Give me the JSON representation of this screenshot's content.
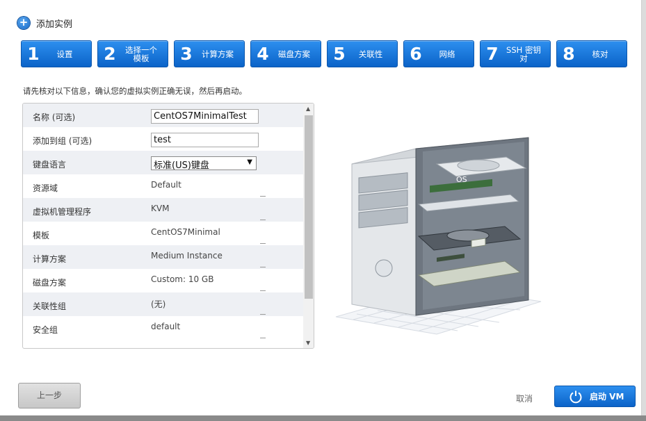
{
  "header": {
    "title": "添加实例",
    "icon": "plus-icon"
  },
  "steps": [
    {
      "num": "1",
      "label": "设置"
    },
    {
      "num": "2",
      "label": "选择一个模板"
    },
    {
      "num": "3",
      "label": "计算方案"
    },
    {
      "num": "4",
      "label": "磁盘方案"
    },
    {
      "num": "5",
      "label": "关联性"
    },
    {
      "num": "6",
      "label": "网络"
    },
    {
      "num": "7",
      "label": "SSH 密钥对"
    },
    {
      "num": "8",
      "label": "核对"
    }
  ],
  "intro": "请先核对以下信息，确认您的虚拟实例正确无误，然后再启动。",
  "summary": {
    "name": {
      "label": "名称 (可选)",
      "value": "CentOS7MinimalTest"
    },
    "group": {
      "label": "添加到组 (可选)",
      "value": "test"
    },
    "keyboard": {
      "label": "键盘语言",
      "value": "标准(US)键盘"
    },
    "zone": {
      "label": "资源域",
      "value": "Default"
    },
    "hypervisor": {
      "label": "虚拟机管理程序",
      "value": "KVM"
    },
    "template": {
      "label": "模板",
      "value": "CentOS7Minimal"
    },
    "compute": {
      "label": "计算方案",
      "value": "Medium Instance"
    },
    "disk": {
      "label": "磁盘方案",
      "value": "Custom: 10 GB"
    },
    "affinity": {
      "label": "关联性组",
      "value": "(无)"
    },
    "security": {
      "label": "安全组",
      "value": "default"
    }
  },
  "illustration": {
    "os_label": "OS"
  },
  "footer": {
    "back_label": "上一步",
    "cancel_label": "取消",
    "launch_label": "启动 VM",
    "launch_icon": "power-icon"
  },
  "colors": {
    "accent": "#1a78de",
    "row_alt": "#eef0f4"
  }
}
